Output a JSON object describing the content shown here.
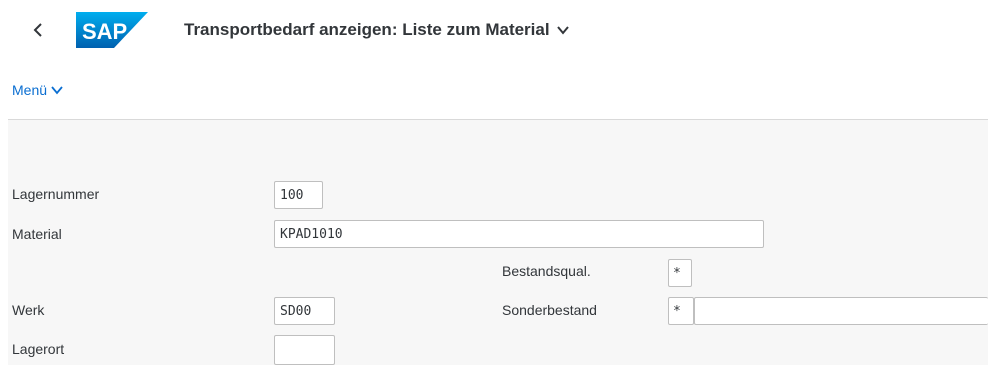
{
  "header": {
    "back_icon": "chevron-left-icon",
    "logo_text": "SAP",
    "title": "Transportbedarf anzeigen: Liste zum Material",
    "title_chevron_icon": "chevron-down-icon"
  },
  "menu": {
    "label": "Menü",
    "chevron_icon": "chevron-down-icon"
  },
  "form": {
    "lagernummer": {
      "label": "Lagernummer",
      "value": "100"
    },
    "material": {
      "label": "Material",
      "value": "KPAD1010"
    },
    "bestandsqual": {
      "label": "Bestandsqual.",
      "value": "*"
    },
    "werk": {
      "label": "Werk",
      "value": "SD00"
    },
    "sonderbestand": {
      "label": "Sonderbestand",
      "value": "*",
      "value2": ""
    },
    "lagerort": {
      "label": "Lagerort",
      "value": ""
    }
  },
  "colors": {
    "brand_blue": "#0a6ed1",
    "text": "#32363a",
    "content_bg": "#f7f7f7"
  }
}
